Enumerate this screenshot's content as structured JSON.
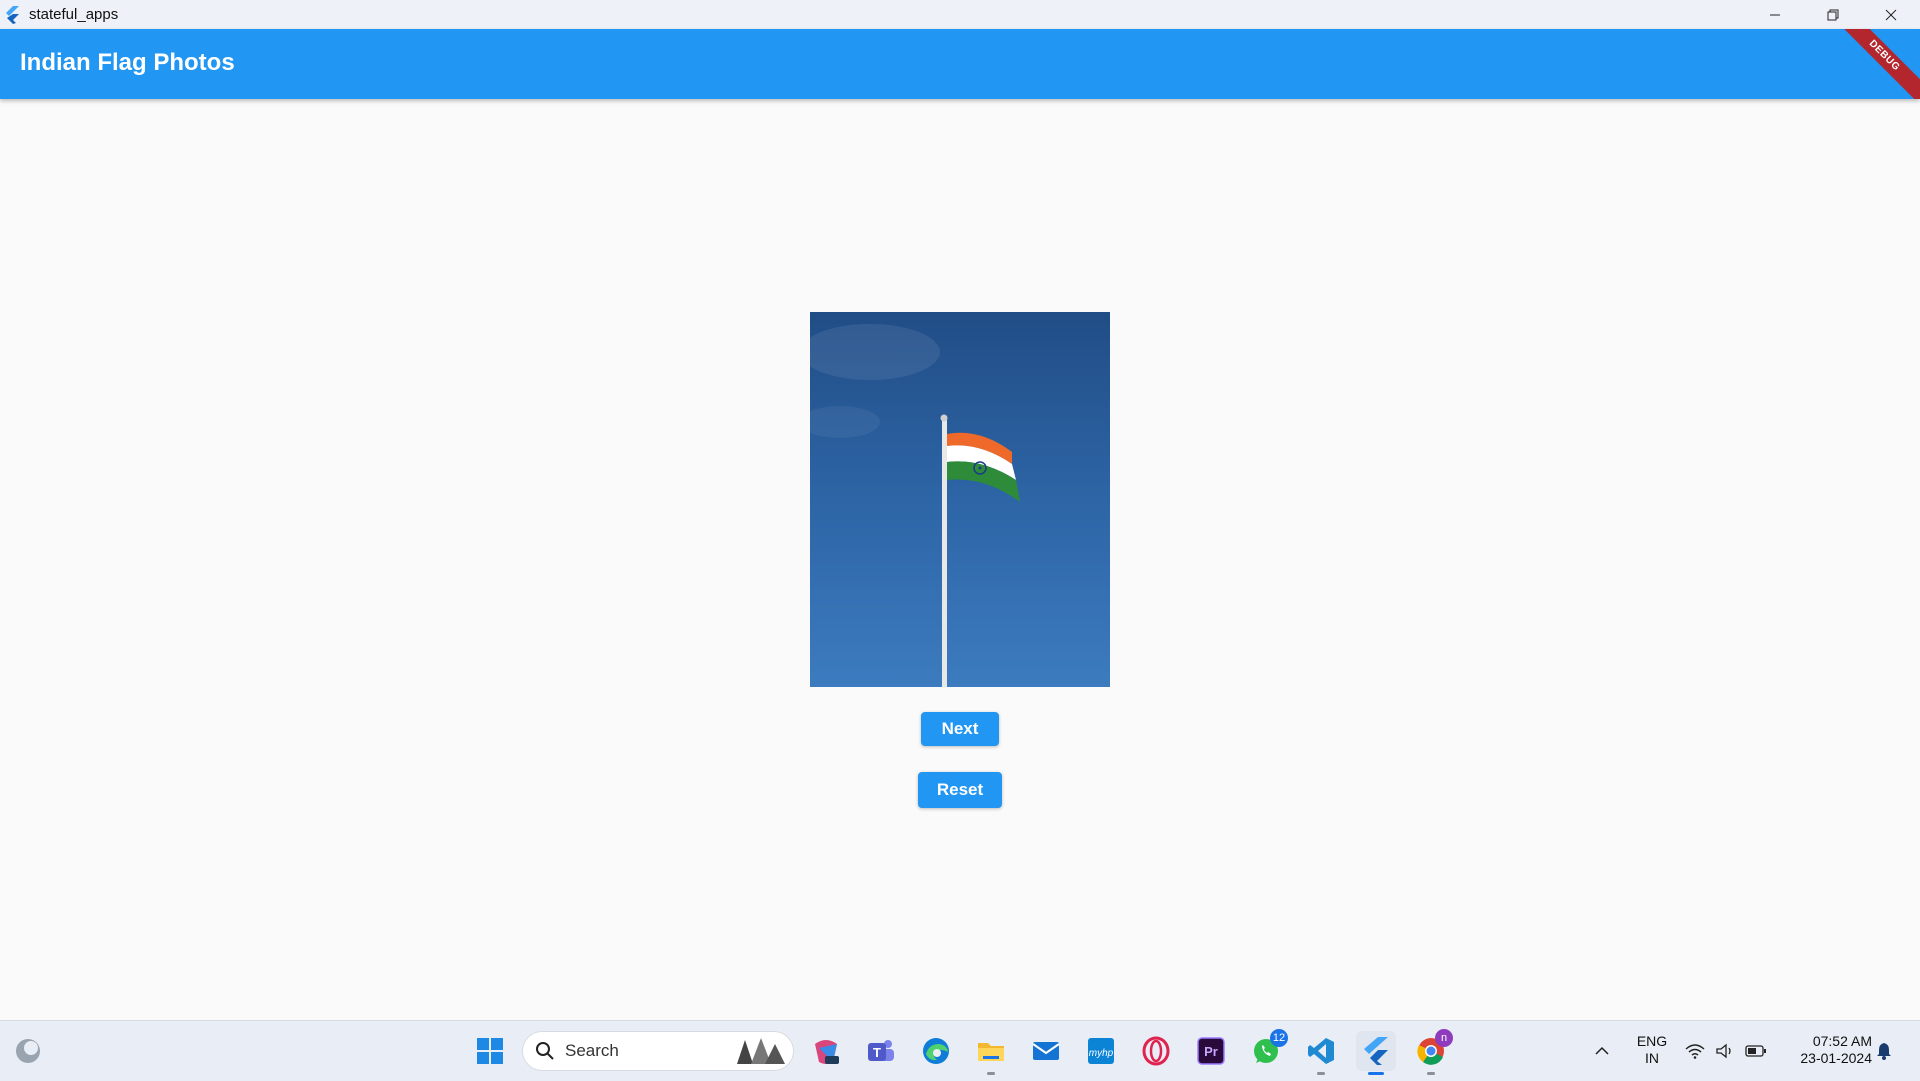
{
  "window": {
    "title": "stateful_apps"
  },
  "appbar": {
    "title": "Indian Flag Photos",
    "debug_label": "DEBUG",
    "color": "#2196f3"
  },
  "buttons": {
    "next_label": "Next",
    "reset_label": "Reset"
  },
  "taskbar": {
    "search_placeholder": "Search",
    "whatsapp_badge": "12",
    "chrome_badge": "n",
    "language": "ENG",
    "region": "IN",
    "time": "07:52 AM",
    "date": "23-01-2024",
    "icons": [
      "copilot-icon",
      "widgets-icon",
      "start-icon",
      "search-icon",
      "microsoft-365-icon",
      "teams-icon",
      "edge-icon",
      "file-explorer-icon",
      "mail-icon",
      "myhp-icon",
      "opera-icon",
      "premiere-pro-icon",
      "whatsapp-icon",
      "vscode-icon",
      "flutter-icon",
      "chrome-icon",
      "chevron-up-icon",
      "wifi-icon",
      "volume-icon",
      "battery-icon",
      "notification-bell-icon"
    ]
  }
}
